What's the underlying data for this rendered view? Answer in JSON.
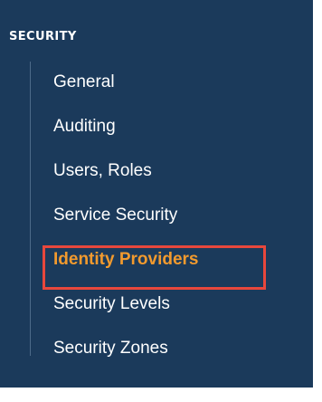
{
  "sidebar": {
    "section_title": "SECURITY",
    "items": [
      {
        "label": "General"
      },
      {
        "label": "Auditing"
      },
      {
        "label": "Users, Roles"
      },
      {
        "label": "Service Security"
      },
      {
        "label": "Identity Providers"
      },
      {
        "label": "Security Levels"
      },
      {
        "label": "Security Zones"
      }
    ],
    "active_item": "Identity Providers"
  },
  "colors": {
    "panel_background": "#1b3a5b",
    "text": "#ffffff",
    "active_text": "#f29a2e",
    "highlight_border": "#e8473c"
  }
}
